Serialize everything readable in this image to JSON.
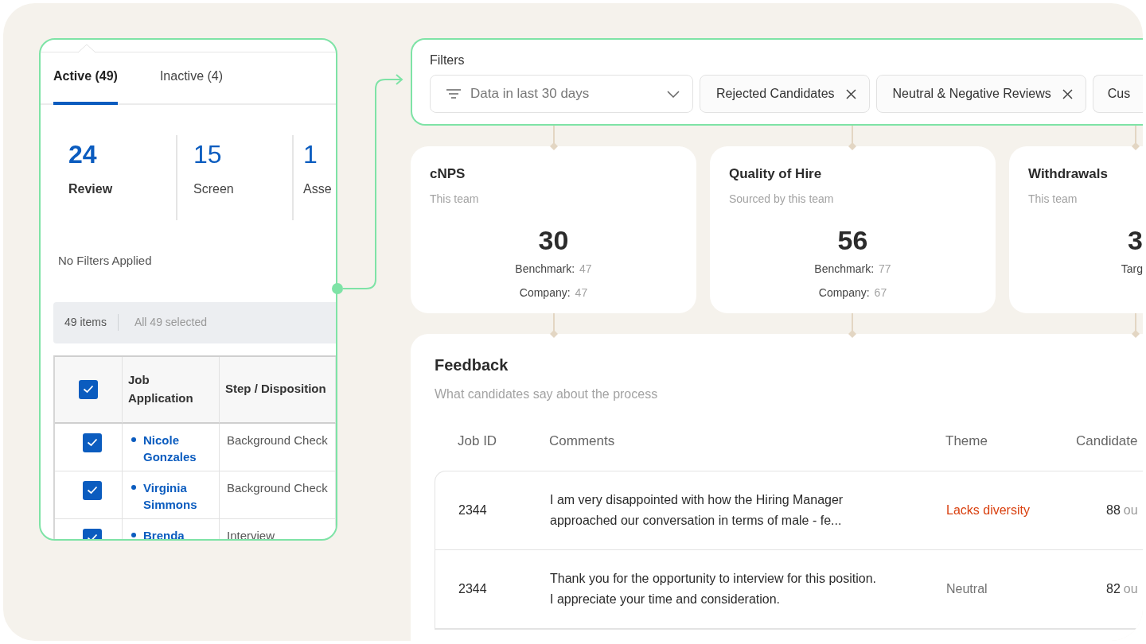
{
  "left_panel": {
    "tabs": [
      {
        "label": "Active (49)",
        "selected": true
      },
      {
        "label": "Inactive (4)",
        "selected": false
      }
    ],
    "stages": [
      {
        "count": "24",
        "label": "Review",
        "selected": true
      },
      {
        "count": "15",
        "label": "Screen",
        "selected": false
      },
      {
        "count": "1",
        "label": "Asse",
        "selected": false
      }
    ],
    "filter_status": "No Filters Applied",
    "selection_bar": {
      "items": "49 items",
      "selected": "All 49 selected"
    },
    "table": {
      "select_all_checked": true,
      "columns": [
        "Job Application",
        "Step / Disposition"
      ],
      "rows": [
        {
          "checked": true,
          "name": "Nicole Gonzales",
          "step": "Background Check"
        },
        {
          "checked": true,
          "name": "Virginia Simmons",
          "step": "Background Check"
        },
        {
          "checked": true,
          "name": "Brenda",
          "step": "Interview"
        }
      ]
    }
  },
  "filters": {
    "title": "Filters",
    "range": {
      "value": "Data in last 30 days"
    },
    "chips": [
      "Rejected Candidates",
      "Neutral & Negative Reviews",
      "Cus"
    ]
  },
  "metrics": [
    {
      "title": "cNPS",
      "subtitle": "This team",
      "value": "30",
      "lines": [
        {
          "label": "Benchmark:",
          "value": "47"
        },
        {
          "label": "Company:",
          "value": "47"
        }
      ]
    },
    {
      "title": "Quality of Hire",
      "subtitle": "Sourced by this team",
      "value": "56",
      "lines": [
        {
          "label": "Benchmark:",
          "value": "77"
        },
        {
          "label": "Company:",
          "value": "67"
        }
      ]
    },
    {
      "title": "Withdrawals",
      "subtitle": "This team",
      "value": "3",
      "lines": [
        {
          "label": "Targ"
        }
      ]
    }
  ],
  "feedback": {
    "title": "Feedback",
    "subtitle": "What candidates say about the process",
    "columns": [
      "Job ID",
      "Comments",
      "Theme",
      "Candidate"
    ],
    "rows": [
      {
        "job_id": "2344",
        "comment": "I am very disappointed with how the Hiring Manager approached our conversation in terms of male - fe...",
        "theme": "Lacks diversity",
        "color": "#d9400f",
        "score": "88",
        "score_suffix": "ou"
      },
      {
        "job_id": "2344",
        "comment": "Thank you for the opportunity to interview for this position. I appreciate your time and consideration.",
        "theme": "Neutral",
        "color": "#737373",
        "score": "82",
        "score_suffix": "ou"
      }
    ]
  }
}
